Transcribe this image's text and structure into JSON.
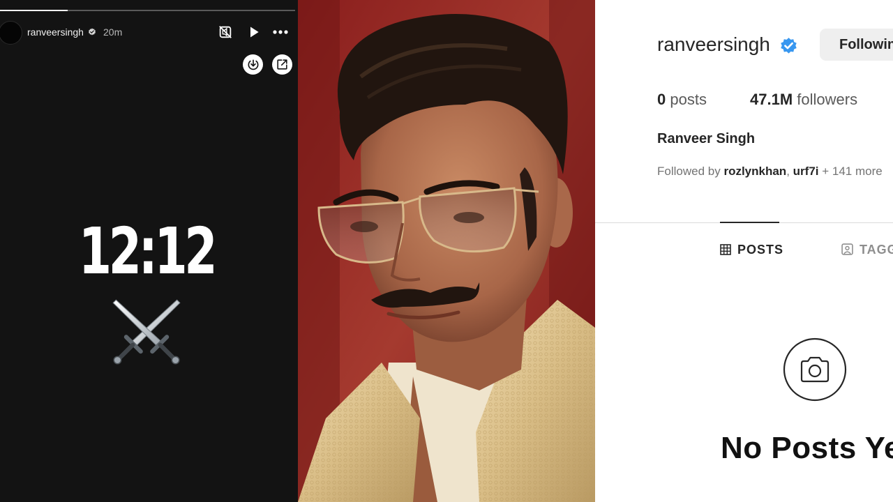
{
  "story": {
    "progress": 0.23,
    "username": "ranveersingh",
    "age": "20m",
    "controls": [
      "mute-off-icon",
      "play-icon",
      "more-icon"
    ],
    "round_buttons": [
      "download-icon",
      "share-icon"
    ],
    "time_text": "12:12",
    "emoji": "⚔️"
  },
  "profile": {
    "username": "ranveersingh",
    "follow_label": "Following",
    "posts_count": "0",
    "posts_label": "posts",
    "followers_count": "47.1M",
    "followers_label": "followers",
    "full_name": "Ranveer Singh",
    "followed_by_prefix": "Followed by",
    "followed_by_user1": "rozlynkhan",
    "followed_by_sep": ",",
    "followed_by_user2": "urf7i",
    "followed_by_more": "+ 141 more",
    "tabs": [
      {
        "label": "POSTS",
        "icon": "grid-icon",
        "active": true
      },
      {
        "label": "TAGGED",
        "icon": "tagged-icon",
        "active": false
      }
    ],
    "empty_state_title": "No Posts Yet"
  },
  "colors": {
    "verified_blue": "#3897f0",
    "story_bg": "#131313",
    "portrait_bg": "#8e2323"
  }
}
